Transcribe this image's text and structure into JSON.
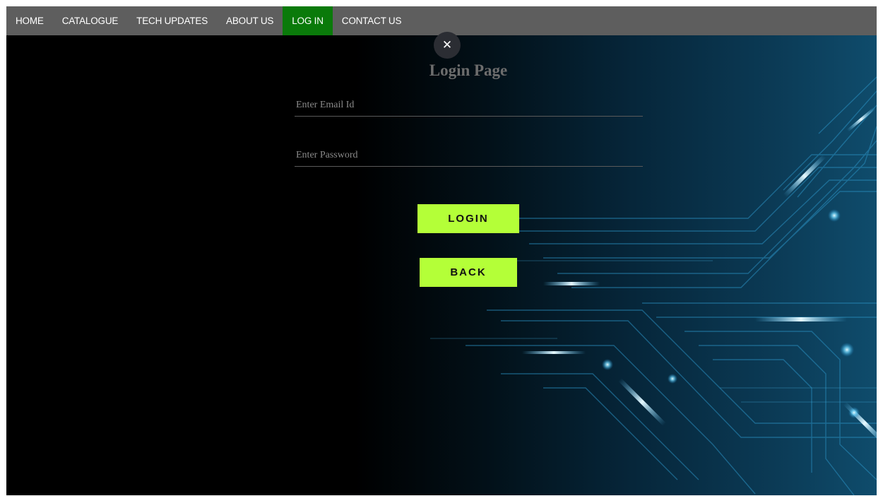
{
  "nav": {
    "items": [
      {
        "label": "HOME",
        "active": false
      },
      {
        "label": "CATALOGUE",
        "active": false
      },
      {
        "label": "TECH UPDATES",
        "active": false
      },
      {
        "label": "ABOUT US",
        "active": false
      },
      {
        "label": "LOG IN",
        "active": true
      },
      {
        "label": "CONTACT US",
        "active": false
      }
    ],
    "bar_color": "#5e5e5e",
    "active_color": "#0a7a0a"
  },
  "modal": {
    "close_icon": "close-icon",
    "close_glyph": "✕",
    "title": "Login Page",
    "email_placeholder": "Enter Email Id",
    "email_value": "",
    "password_placeholder": "Enter Password",
    "password_value": "",
    "login_label": "LOGIN",
    "back_label": "BACK",
    "button_color": "#b4ff38"
  },
  "background": {
    "theme": "circuit-board",
    "colors": [
      "#000000",
      "#0c3a52",
      "#4fd0ff"
    ]
  }
}
